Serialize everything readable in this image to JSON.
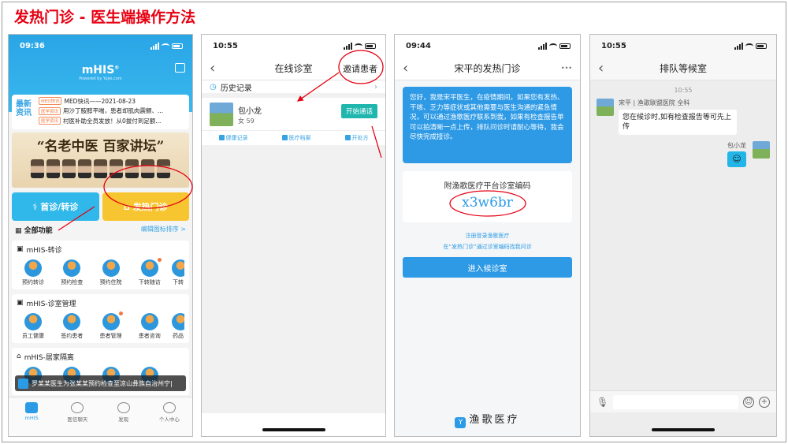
{
  "slide_title": "发热门诊 - 医生端操作方法",
  "phone1": {
    "time": "09:36",
    "brand": "mHIS",
    "brand_sup": "®",
    "brand_sub": "Powered by Yujie.com",
    "news_tag": "最新资讯",
    "news": [
      {
        "badge": "MED快讯",
        "text": "MED快讯——2021-08-23"
      },
      {
        "badge": "医学资讯",
        "text": "用沙丁胺醇平喘，患者却肌肉震颤、..."
      },
      {
        "badge": "医学资讯",
        "text": "村医补助全员发放！从0拔付到足额..."
      }
    ],
    "banner_text": "“名老中医  百家讲坛”",
    "btn_zz": "首诊/转诊",
    "btn_fr": "发热门诊",
    "all_title": "全部功能",
    "all_edit": "编辑图标排序 >",
    "sections": [
      {
        "title": "mHIS-转诊",
        "items": [
          "预约转诊",
          "预约检查",
          "预约住院",
          "下转随访",
          "下转"
        ]
      },
      {
        "title": "mHIS-诊室管理",
        "items": [
          "员工健康",
          "签约患者",
          "患者管理",
          "患者咨询",
          "药品"
        ]
      },
      {
        "title": "mHIS-居家隔离",
        "items": [
          "",
          "",
          "",
          "",
          ""
        ]
      }
    ],
    "toast": "罗某某医生为张某某预约检查至凉山彝族自治州宁|",
    "tabs": [
      "mHIS",
      "医信聊天",
      "发现",
      "个人中心"
    ]
  },
  "phone2": {
    "time": "10:55",
    "title": "在线诊室",
    "invite": "邀请患者",
    "history": "历史记录",
    "patient_name": "包小龙",
    "patient_info": "女 59",
    "start_call": "开始通话",
    "actions": [
      "健康记录",
      "医疗档案",
      "开处方"
    ]
  },
  "phone3": {
    "time": "09:44",
    "title": "宋平的发热门诊",
    "more": "•••",
    "info": "您好，我是宋平医生，在疫情期间，如果您有发热、干咳、乏力等症状或其他需要与医生沟通的紧急情况，可以通过渔歌医疗联系到我，如果有检查报告单可以拍清晰一点上传，排队问诊时请耐心等待，我会尽快完成接诊。",
    "code_label": "附渔歌医疗平台诊室编码",
    "code_value": "x3w6br",
    "link1": "注册登录渔歌医疗",
    "link2": "在“发热门诊”通过诊室编码找我问诊",
    "enter": "进入候诊室",
    "logo": "渔歌医疗",
    "logo_mark": "Y"
  },
  "phone4": {
    "time": "10:55",
    "title": "排队等候室",
    "chat_time": "10:55",
    "sender": "宋平 | 渔歌联盟医院 全科",
    "message": "您在候诊时,如有检查报告等可先上传",
    "reply_name": "包小龙",
    "reply_emoji": "☺"
  },
  "colors": {
    "accent": "#2b9be6",
    "title_red": "#e60012",
    "call_green": "#1fb6ae",
    "fever_yellow": "#f7c52f"
  }
}
